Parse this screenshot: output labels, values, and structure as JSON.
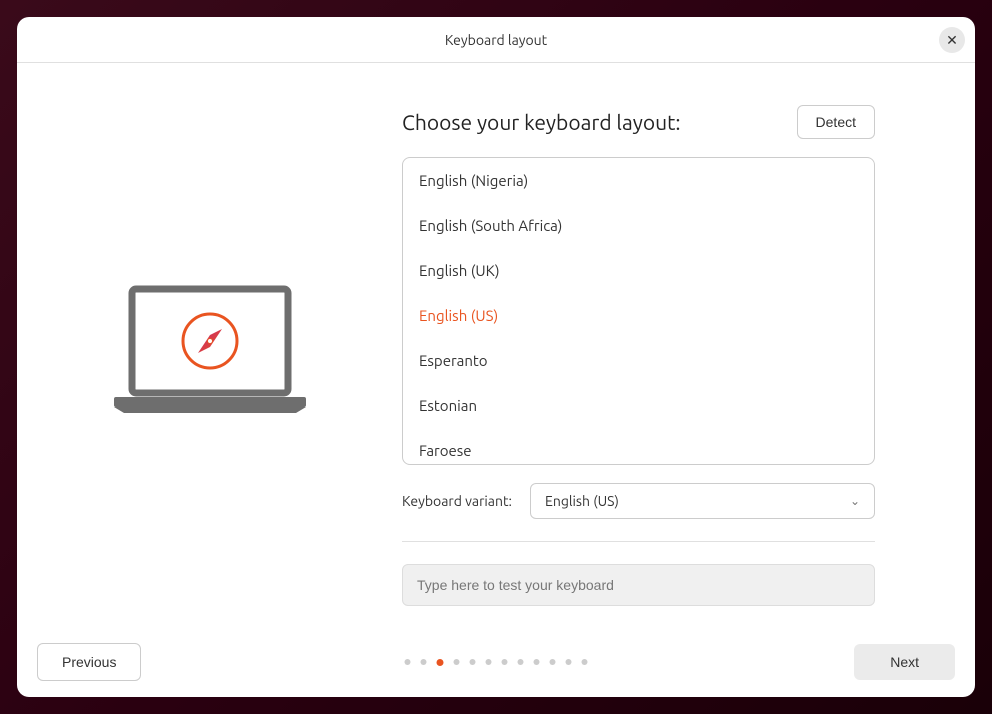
{
  "window": {
    "title": "Keyboard layout"
  },
  "heading": "Choose your keyboard layout:",
  "detect_button": "Detect",
  "layouts": [
    "English (Nigeria)",
    "English (South Africa)",
    "English (UK)",
    "English (US)",
    "Esperanto",
    "Estonian",
    "Faroese"
  ],
  "selected_layout_index": 3,
  "variant": {
    "label": "Keyboard variant:",
    "selected": "English (US)"
  },
  "test_input": {
    "placeholder": "Type here to test your keyboard"
  },
  "navigation": {
    "previous": "Previous",
    "next": "Next",
    "total_steps": 12,
    "current_step": 2
  },
  "accent_color": "#e95420"
}
